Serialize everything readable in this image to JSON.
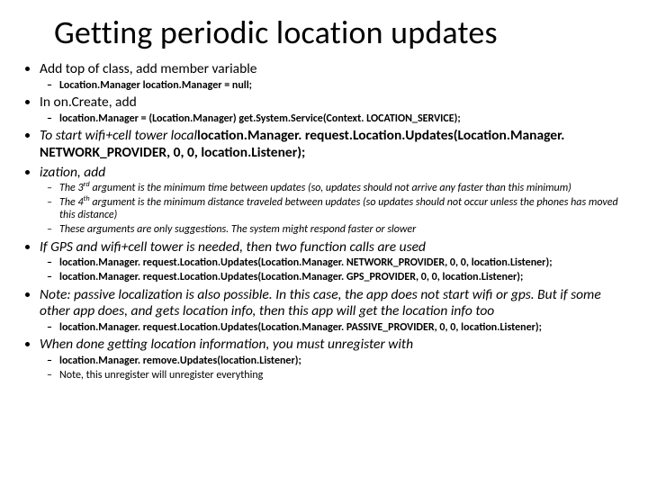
{
  "title": "Getting periodic location updates",
  "b1": {
    "text": "Add top of class, add member variable",
    "sub": [
      "Location.Manager location.Manager = null;"
    ]
  },
  "b2": {
    "text": "In on.Create, add",
    "sub": [
      "location.Manager = (Location.Manager) get.System.Service(Context. LOCATION_SERVICE);"
    ]
  },
  "b3": {
    "lead": "To start wifi+cell tower local",
    "code": "location.Manager. request.Location.Updates(Location.Manager. NETWORK_PROVIDER, 0, 0, location.Listener);"
  },
  "b4": {
    "text": "ization, add",
    "sub_3_a": "The 3",
    "sub_3_b": " argument is the minimum time between updates (so, updates should not arrive any faster than this minimum)",
    "sub_4_a": "The 4",
    "sub_4_b": " argument is the minimum distance traveled between updates (so updates should not occur unless the phones has moved this distance)",
    "sub_c": "These arguments are only suggestions. The system might respond faster or slower"
  },
  "b5": {
    "text": "If GPS and wifi+cell tower is needed, then two function calls are used",
    "sub": [
      "location.Manager. request.Location.Updates(Location.Manager. NETWORK_PROVIDER, 0, 0, location.Listener);",
      "location.Manager. request.Location.Updates(Location.Manager. GPS_PROVIDER, 0, 0, location.Listener);"
    ]
  },
  "b6": {
    "text": "Note: passive localization is also possible. In this case, the app does not start wifi or gps. But if some other app does, and gets location info, then this app will get the location info too",
    "sub": [
      "location.Manager. request.Location.Updates(Location.Manager. PASSIVE_PROVIDER, 0, 0, location.Listener);"
    ]
  },
  "b7": {
    "text": "When done getting location information, you must unregister with",
    "sub": [
      "location.Manager. remove.Updates(location.Listener);",
      "Note, this unregister will unregister everything"
    ]
  },
  "sup": {
    "rd": "rd",
    "th": "th"
  }
}
